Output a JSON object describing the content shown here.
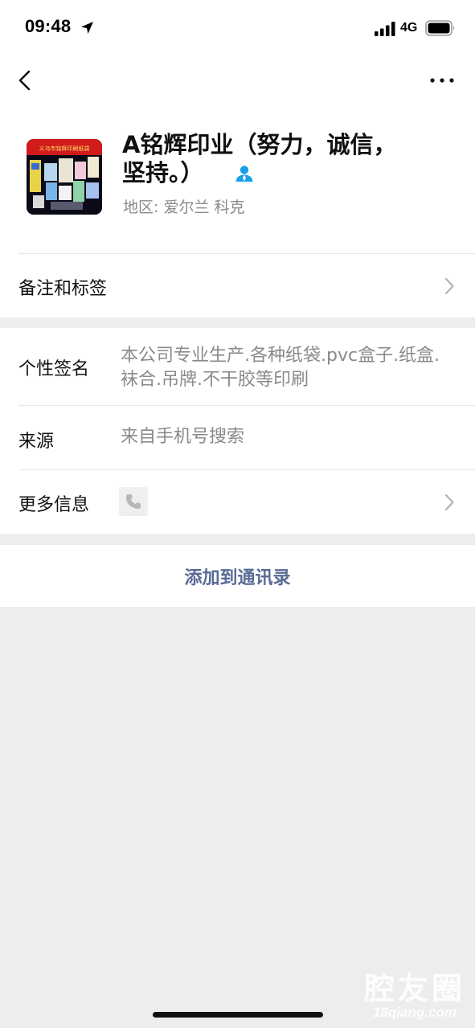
{
  "status_bar": {
    "time": "09:48",
    "network": "4G"
  },
  "nav": {
    "back_icon": "chevron-left-icon",
    "more_icon": "ellipsis-icon"
  },
  "profile": {
    "name": "A铭辉印业（努力，诚信，坚持。）",
    "region_label": "地区:",
    "region_value": "爱尔兰 科克",
    "avatar_banner": "义乌市铭辉印刷纸袋"
  },
  "rows": {
    "remarks_label": "备注和标签",
    "signature_label": "个性签名",
    "signature_value": "本公司专业生产.各种纸袋.pvc盒子.纸盒.袜合.吊牌.不干胶等印刷",
    "source_label": "来源",
    "source_value": "来自手机号搜索",
    "more_info_label": "更多信息"
  },
  "actions": {
    "add_contact": "添加到通讯录"
  },
  "watermark": {
    "logo": "腔友圈",
    "url": "18qiang.com"
  },
  "colors": {
    "link_blue": "#576b95",
    "secondary_text": "#8a8a8a",
    "page_background": "#ededed"
  }
}
